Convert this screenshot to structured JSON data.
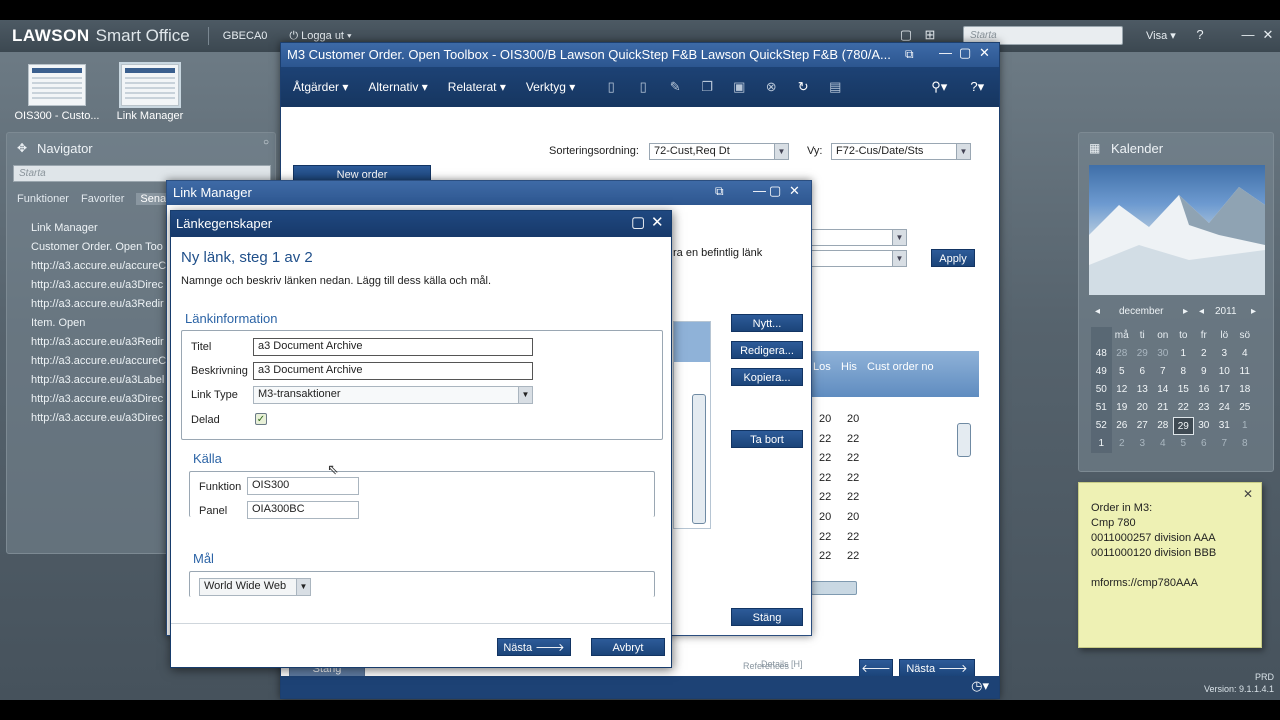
{
  "app": {
    "brand": "LAWSON",
    "brand_sub": "Smart Office",
    "user": "GBECA0",
    "logout": "Logga ut",
    "search_placeholder": "Starta",
    "visa": "Visa",
    "prd": "PRD",
    "version": "Version: 9.1.1.4.1"
  },
  "shortcuts": [
    {
      "label": "OIS300 - Custo..."
    },
    {
      "label": "Link Manager"
    }
  ],
  "navigator": {
    "title": "Navigator",
    "search_placeholder": "Starta",
    "tabs": [
      "Funktioner",
      "Favoriter",
      "Sena"
    ],
    "items": [
      "Link Manager",
      "Customer Order. Open Too",
      "http://a3.accure.eu/accureC",
      "http://a3.accure.eu/a3Direc",
      "http://a3.accure.eu/a3Redir",
      "Item. Open",
      "http://a3.accure.eu/a3Redir",
      "http://a3.accure.eu/accureC",
      "http://a3.accure.eu/a3Label",
      "http://a3.accure.eu/a3Direc",
      "http://a3.accure.eu/a3Direc"
    ]
  },
  "m3": {
    "title": "M3 Customer Order. Open Toolbox - OIS300/B   Lawson QuickStep F&B Lawson QuickStep F&B (780/A...",
    "menus": [
      "Åtgärder",
      "Alternativ",
      "Relaterat",
      "Verktyg"
    ],
    "sort_label": "Sorteringsordning:",
    "sort_value": "72-Cust,Req Dt",
    "vy_label": "Vy:",
    "vy_value": "F72-Cus/Date/Sts",
    "new_order": "New order",
    "apply": "Apply",
    "existing_link_text": "ra en befintlig länk",
    "grid_headers": [
      "Los",
      "His",
      "Cust order no"
    ],
    "grid_rows": [
      [
        "20",
        "20"
      ],
      [
        "22",
        "22"
      ],
      [
        "22",
        "22"
      ],
      [
        "22",
        "22"
      ],
      [
        "22",
        "22"
      ],
      [
        "20",
        "20"
      ],
      [
        "22",
        "22"
      ],
      [
        "22",
        "22"
      ]
    ],
    "bottom_tabs": [
      "References",
      "Details [H]"
    ],
    "stang_bottom": "Stäng",
    "next_button": "Nästa"
  },
  "link_manager": {
    "title": "Link Manager",
    "buttons": [
      "Nytt...",
      "Redigera...",
      "Kopiera...",
      "Ta bort",
      "Stäng"
    ]
  },
  "dialog": {
    "title": "Länkegenskaper",
    "heading": "Ny länk, steg 1 av 2",
    "description": "Namnge och beskriv länken nedan. Lägg till dess källa och mål.",
    "section_info": "Länkinformation",
    "titel_label": "Titel",
    "titel_value": "a3 Document Archive",
    "beskrivning_label": "Beskrivning",
    "beskrivning_value": "a3 Document Archive",
    "linktype_label": "Link Type",
    "linktype_value": "M3-transaktioner",
    "delad_label": "Delad",
    "section_source": "Källa",
    "funktion_label": "Funktion",
    "funktion_value": "OIS300",
    "panel_label": "Panel",
    "panel_value": "OIA300BC",
    "section_target": "Mål",
    "target_value": "World Wide Web",
    "next": "Nästa",
    "cancel": "Avbryt"
  },
  "calendar": {
    "title": "Kalender",
    "month": "december",
    "year": "2011",
    "weekday_headers": [
      "må",
      "ti",
      "on",
      "to",
      "fr",
      "lö",
      "sö"
    ],
    "weeks": [
      {
        "wk": "48",
        "days": [
          "28",
          "29",
          "30",
          "1",
          "2",
          "3",
          "4"
        ]
      },
      {
        "wk": "49",
        "days": [
          "5",
          "6",
          "7",
          "8",
          "9",
          "10",
          "11"
        ]
      },
      {
        "wk": "50",
        "days": [
          "12",
          "13",
          "14",
          "15",
          "16",
          "17",
          "18"
        ]
      },
      {
        "wk": "51",
        "days": [
          "19",
          "20",
          "21",
          "22",
          "23",
          "24",
          "25"
        ]
      },
      {
        "wk": "52",
        "days": [
          "26",
          "27",
          "28",
          "29",
          "30",
          "31",
          "1"
        ]
      },
      {
        "wk": "1",
        "days": [
          "2",
          "3",
          "4",
          "5",
          "6",
          "7",
          "8"
        ]
      }
    ],
    "today": "29"
  },
  "note": {
    "lines": [
      "Order in M3:",
      "Cmp 780",
      "0011000257 division AAA",
      "0011000120 division BBB",
      "",
      "mforms://cmp780AAA"
    ]
  },
  "colors": {
    "title_blue": "#2c5690",
    "toolbar_navy": "#1d4275",
    "heading_blue": "#1f4f8a",
    "note_yellow": "#eef1b4"
  }
}
